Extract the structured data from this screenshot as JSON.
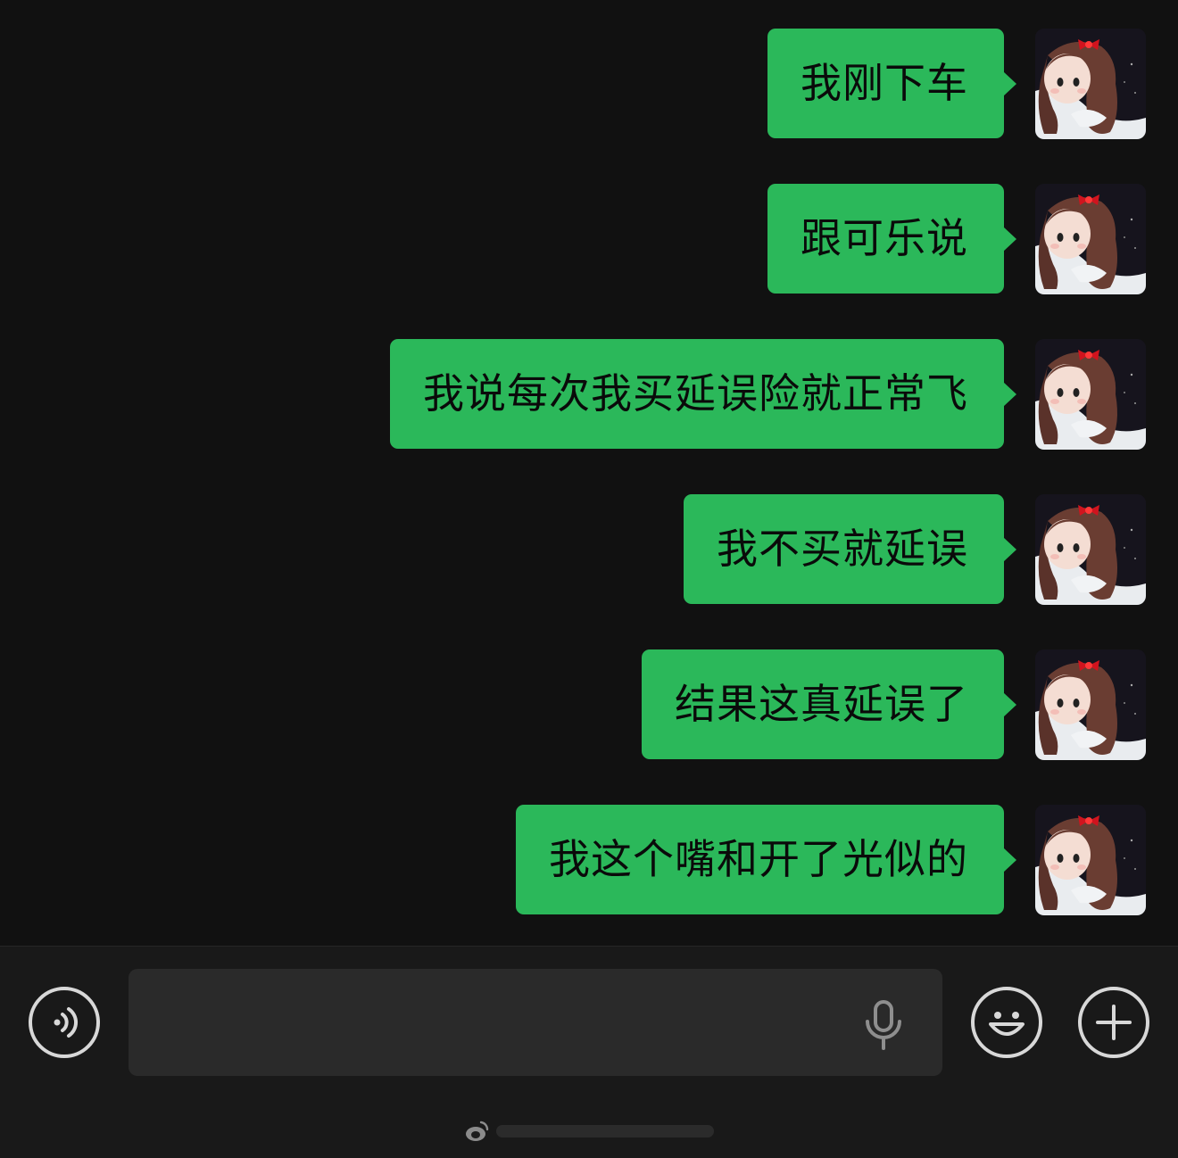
{
  "chat": {
    "messages": [
      {
        "text": "我刚下车",
        "sender": "me"
      },
      {
        "text": "跟可乐说",
        "sender": "me"
      },
      {
        "text": "我说每次我买延误险就正常飞",
        "sender": "me"
      },
      {
        "text": "我不买就延误",
        "sender": "me"
      },
      {
        "text": "结果这真延误了",
        "sender": "me"
      },
      {
        "text": "我这个嘴和开了光似的",
        "sender": "me"
      }
    ]
  },
  "input_bar": {
    "voice_icon": "voice-mode-icon",
    "text_value": "",
    "mic_icon": "microphone-icon",
    "emoji_icon": "emoji-icon",
    "plus_icon": "plus-icon"
  },
  "colors": {
    "background": "#111111",
    "bubble": "#2bb85a",
    "input_bar": "#191919",
    "input_field": "#2a2a2a"
  }
}
